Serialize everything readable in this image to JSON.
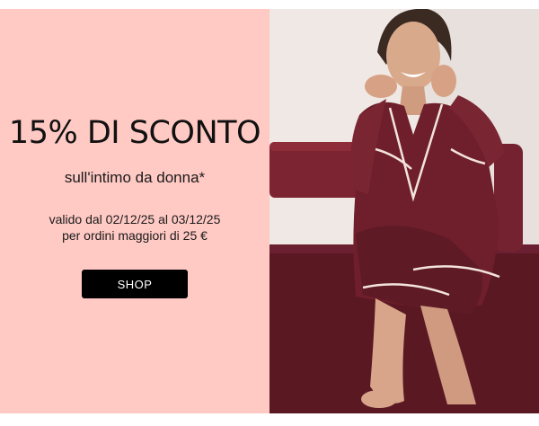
{
  "promo": {
    "headline": "15% DI SCONTO",
    "subhead": "sull'intimo da donna*",
    "terms_line1": "valido dal 02/12/25 al 03/12/25",
    "terms_line2": "per ordini maggiori di 25 €",
    "cta_label": "SHOP"
  },
  "colors": {
    "panel_background": "#ffc9c4",
    "button_background": "#000000",
    "button_text": "#ffffff",
    "pajama": "#6e1f2b",
    "rug": "#5a1823"
  },
  "photo": {
    "subject": "woman-in-burgundy-satin-pajamas"
  }
}
